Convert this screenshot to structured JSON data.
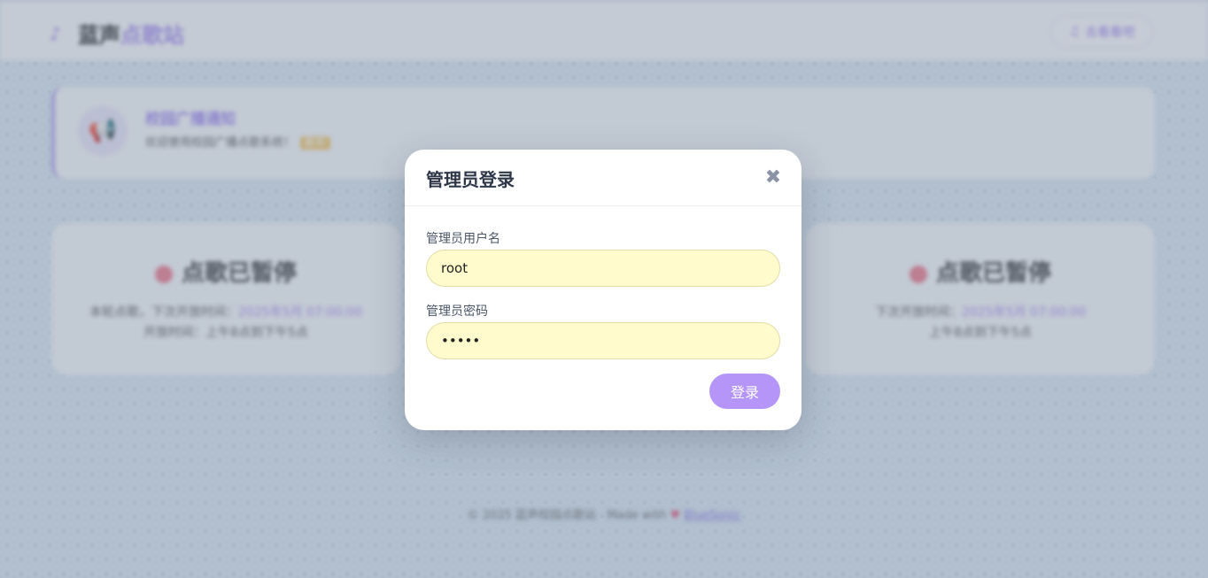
{
  "site": {
    "logo_icon": "music-note-icon",
    "name_part1": "蓝声",
    "name_part2": "点歌站",
    "top_button_label": "去看看吧"
  },
  "notice": {
    "title": "校园广播通知",
    "body": "欢迎使用校园广播点歌系统！",
    "tag": "最新"
  },
  "status_cards": [
    {
      "title": "点歌已暂停",
      "line1_prefix": "本轮点歌，下次开放时间：",
      "line1_value": "2025年5月 07:00:00",
      "line2": "开放时间：上午8点到下午5点"
    },
    {
      "title": "点歌已暂停",
      "line1_prefix": "下次开放时间：",
      "line1_value": "2025年5月 07:00:00",
      "line2": "上午8点到下午5点"
    }
  ],
  "footer": {
    "copyright": "© 2025 蓝声校园点歌站 · Made with",
    "heart": "♥",
    "link": "BlueSonic"
  },
  "modal": {
    "title": "管理员登录",
    "close_icon": "close-icon",
    "username_label": "管理员用户名",
    "username_value": "root",
    "password_label": "管理员密码",
    "password_value": "•••••",
    "submit_label": "登录"
  },
  "colors": {
    "accent": "#b595f7",
    "input_autofill": "#fffbcc",
    "title_text": "#2d3748"
  }
}
